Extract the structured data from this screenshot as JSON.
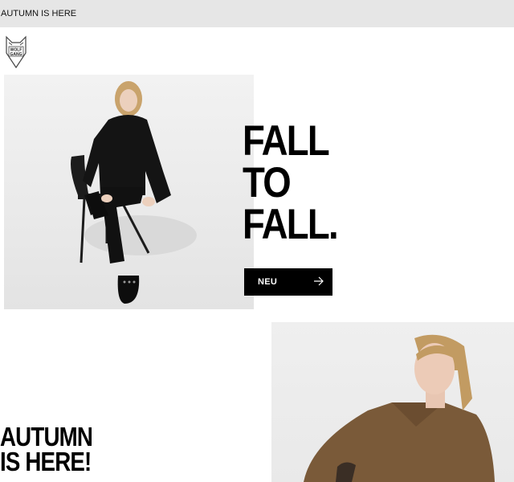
{
  "topbar": {
    "text": "AUTUMN IS HERE"
  },
  "logo": {
    "icon": "wolf-head-icon",
    "lines": [
      "WOLF",
      "GANG"
    ]
  },
  "hero": {
    "headline_lines": [
      "FALL",
      "TO",
      "FALL."
    ],
    "cta_label": "NEU",
    "cta_icon": "arrow-right-icon"
  },
  "section2": {
    "title_lines": [
      "AUTUMN",
      "IS HERE!"
    ]
  },
  "colors": {
    "topbar_bg": "#e6e6e6",
    "button_bg": "#000000",
    "coat": "#7a5a39"
  }
}
